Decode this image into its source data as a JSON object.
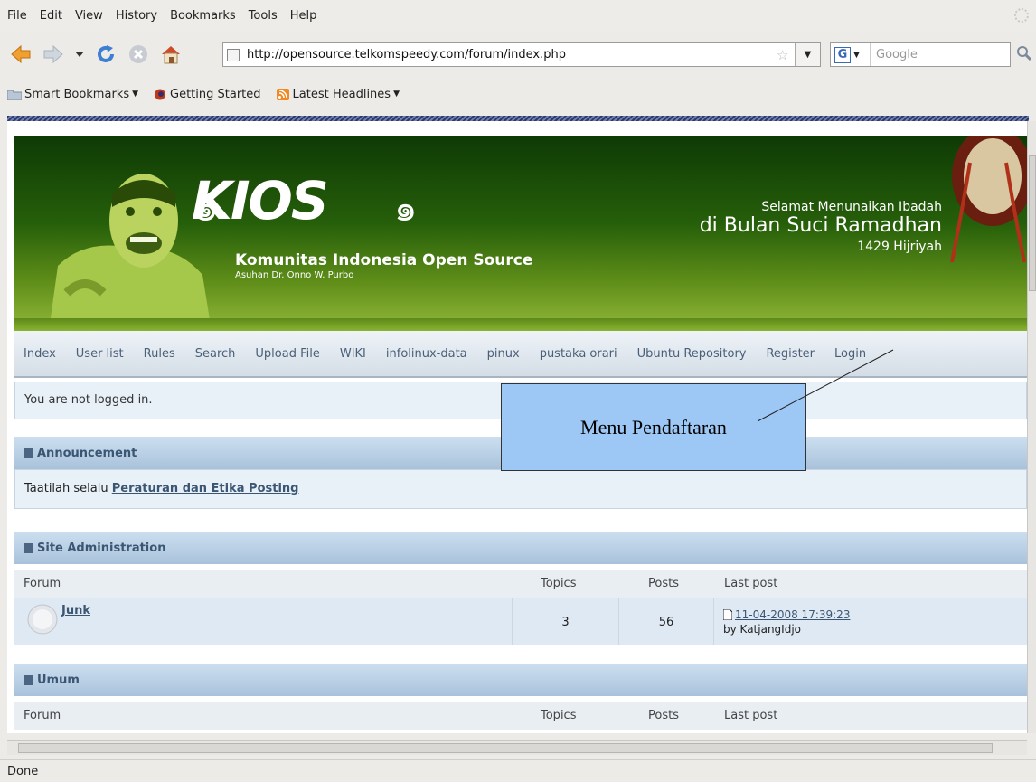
{
  "browser": {
    "menu": [
      "File",
      "Edit",
      "View",
      "History",
      "Bookmarks",
      "Tools",
      "Help"
    ],
    "url": "http://opensource.telkomspeedy.com/forum/index.php",
    "search_placeholder": "Google",
    "bookmarks": [
      "Smart Bookmarks",
      "Getting Started",
      "Latest Headlines"
    ],
    "status": "Done"
  },
  "banner": {
    "logo": "KIOS",
    "site_name": "Komunitas Indonesia Open Source",
    "site_by": "Asuhan Dr. Onno W. Purbo",
    "greeting_line1": "Selamat Menunaikan Ibadah",
    "greeting_line2": "di Bulan Suci Ramadhan",
    "greeting_line3": "1429 Hijriyah"
  },
  "nav": [
    "Index",
    "User list",
    "Rules",
    "Search",
    "Upload File",
    "WIKI",
    "infolinux-data",
    "pinux",
    "pustaka orari",
    "Ubuntu Repository",
    "Register",
    "Login"
  ],
  "login_status": "You are not logged in.",
  "announcement": {
    "title": "Announcement",
    "text": "Taatilah selalu",
    "link": "Peraturan dan Etika Posting"
  },
  "columns": {
    "forum": "Forum",
    "topics": "Topics",
    "posts": "Posts",
    "last_post": "Last post"
  },
  "categories": [
    {
      "title": "Site Administration",
      "forums": [
        {
          "name": "Junk",
          "topics": "3",
          "posts": "56",
          "last_post_date": "11-04-2008 17:39:23",
          "last_post_by": "by KatjangIdjo"
        }
      ]
    },
    {
      "title": "Umum"
    }
  ],
  "callout": "Menu Pendaftaran"
}
